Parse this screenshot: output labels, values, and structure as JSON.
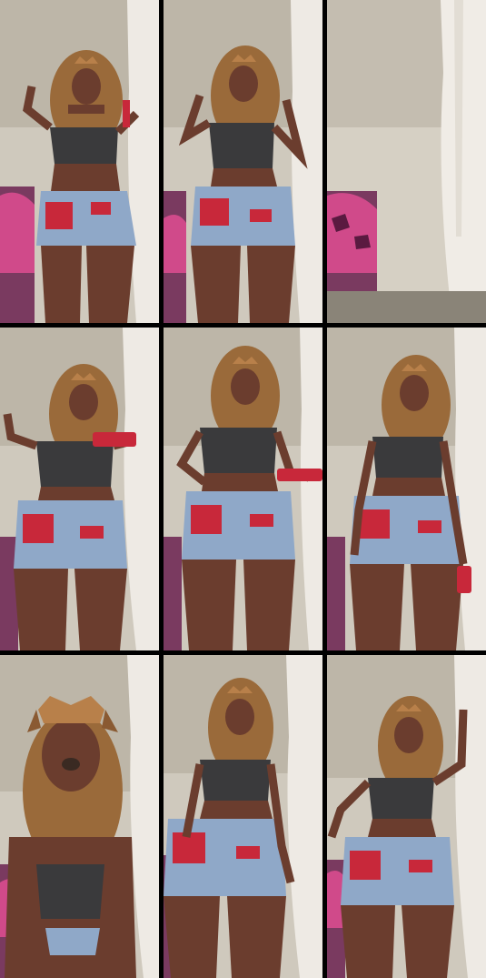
{
  "grid": {
    "rows": 3,
    "columns": 3,
    "frames": [
      {
        "id": "frame-1",
        "scene": "person"
      },
      {
        "id": "frame-2",
        "scene": "person"
      },
      {
        "id": "frame-3",
        "scene": "empty-room"
      },
      {
        "id": "frame-4",
        "scene": "person"
      },
      {
        "id": "frame-5",
        "scene": "person"
      },
      {
        "id": "frame-6",
        "scene": "person"
      },
      {
        "id": "frame-7",
        "scene": "person-closeup"
      },
      {
        "id": "frame-8",
        "scene": "person"
      },
      {
        "id": "frame-9",
        "scene": "person"
      }
    ]
  },
  "colors": {
    "background": "#000000",
    "wall": "#cfc9bd",
    "curtain": "#eeeae4",
    "skin": "#6b3d2e",
    "top": "#3a3a3c",
    "shorts": "#8fa8c8",
    "patch_red": "#c8283a",
    "hair": "#9a6a3a",
    "filter_ears": "#b8804a",
    "pink_fabric": "#d04a8a"
  }
}
